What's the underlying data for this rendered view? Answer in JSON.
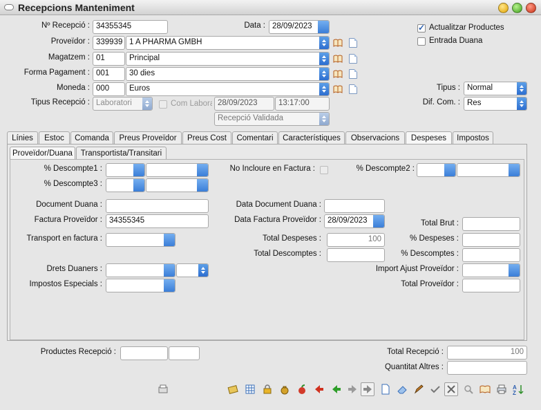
{
  "window": {
    "title": "Recepcions Manteniment"
  },
  "header": {
    "num_recepcio_label": "Nº Recepció :",
    "num_recepcio_value": "34355345",
    "data_label": "Data :",
    "data_value": "28/09/2023",
    "proveidor_label": "Proveïdor :",
    "proveidor_code": "339939",
    "proveidor_name": "1 A PHARMA GMBH",
    "magatzem_label": "Magatzem :",
    "magatzem_code": "01",
    "magatzem_name": "Principal",
    "forma_pagament_label": "Forma Pagament :",
    "forma_pagament_code": "001",
    "forma_pagament_name": "30 dies",
    "moneda_label": "Moneda :",
    "moneda_code": "000",
    "moneda_name": "Euros",
    "tipus_recepcio_label": "Tipus Recepció :",
    "tipus_recepcio_value": "Laboratori",
    "com_labora_label": "Com Labora",
    "tipus_date": "28/09/2023",
    "tipus_time": "13:17:00",
    "estat_value": "Recepció Validada",
    "actualitzar_label": "Actualitzar Productes",
    "entrada_duana_label": "Entrada Duana",
    "tipus_label": "Tipus :",
    "tipus_value": "Normal",
    "dif_com_label": "Dif. Com. :",
    "dif_com_value": "Res"
  },
  "tabs": [
    "Línies",
    "Estoc",
    "Comanda",
    "Preus Proveïdor",
    "Preus Cost",
    "Comentari",
    "Característiques",
    "Observacions",
    "Despeses",
    "Impostos"
  ],
  "selected_tab": "Despeses",
  "subtabs": [
    "Proveïdor/Duana",
    "Transportista/Transitari"
  ],
  "selected_subtab": "Proveïdor/Duana",
  "despeses": {
    "descompte1_label": "% Descompte1 :",
    "descompte3_label": "% Descompte3 :",
    "no_incloure_label": "No Incloure en Factura :",
    "descompte2_label": "% Descompte2 :",
    "document_duana_label": "Document Duana :",
    "data_document_duana_label": "Data Document Duana :",
    "factura_proveidor_label": "Factura Proveïdor :",
    "factura_proveidor_value": "34355345",
    "data_factura_proveidor_label": "Data Factura Proveïdor :",
    "data_factura_proveidor_value": "28/09/2023",
    "total_brut_label": "Total Brut :",
    "transport_label": "Transport en factura :",
    "total_despeses_label": "Total Despeses :",
    "total_despeses_value": "100",
    "pct_despeses_label": "% Despeses :",
    "total_descomptes_label": "Total Descomptes :",
    "pct_descomptes_label": "% Descomptes :",
    "drets_duaners_label": "Drets Duaners :",
    "import_ajust_label": "Import Ajust Proveïdor :",
    "impostos_especials_label": "Impostos Especials :",
    "total_proveidor_label": "Total Proveïdor :"
  },
  "footer": {
    "productes_recepcio_label": "Productes Recepció :",
    "total_recepcio_label": "Total Recepció :",
    "total_recepcio_value": "100",
    "quantitat_altres_label": "Quantitat Altres :"
  },
  "toolbar": {
    "icons": [
      "print-preview-icon",
      "cash-icon",
      "grid-icon",
      "lock-icon",
      "money-bag-icon",
      "apple-icon",
      "arrow-left-red-icon",
      "arrow-left-green-icon",
      "arrow-right-gray-icon",
      "arrow-right-boxed-icon",
      "new-document-icon",
      "eraser-icon",
      "edit-icon",
      "check-icon",
      "cancel-icon",
      "search-icon",
      "book-icon",
      "printer-icon",
      "sort-az-icon"
    ]
  }
}
